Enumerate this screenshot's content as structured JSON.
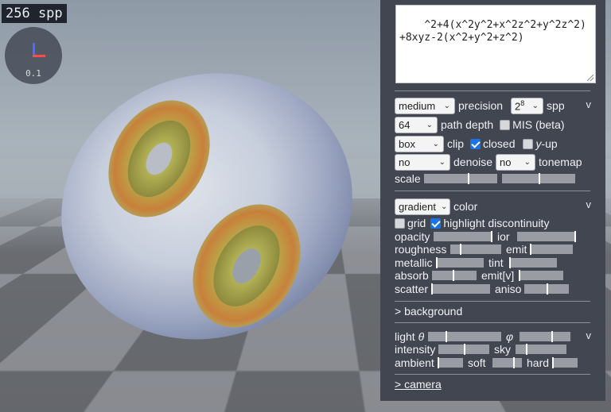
{
  "viewport": {
    "spp_label": "256 spp",
    "axes_scale": "0.1"
  },
  "panel": {
    "formula": "^2+4(x^2y^2+x^2z^2+y^2z^2)+8xyz-2(x^2+y^2+z^2)",
    "render": {
      "precision_value": "medium",
      "precision_label": "precision",
      "spp_value_base": "2",
      "spp_value_exp": "8",
      "spp_label": "spp",
      "toggle": "v",
      "path_depth_value": "64",
      "path_depth_label": "path depth",
      "mis_label": "MIS (beta)",
      "mis_checked": false,
      "clip_value": "box",
      "clip_label": "clip",
      "closed_label": "closed",
      "closed_checked": true,
      "yup_label_italic": "y",
      "yup_label_rest": "-up",
      "yup_checked": false,
      "denoise_value": "no",
      "denoise_label": "denoise",
      "tonemap_value": "no",
      "tonemap_label": "tonemap",
      "scale_label": "scale",
      "scale_value_1": 0.6,
      "scale_value_2": 0.5
    },
    "material": {
      "color_value": "gradient",
      "color_label": "color",
      "toggle": "v",
      "grid_label": "grid",
      "grid_checked": false,
      "highlight_label": "highlight discontinuity",
      "highlight_checked": true,
      "opacity_label": "opacity",
      "opacity_value": 0.99,
      "ior_label": "ior",
      "ior_value": 0.97,
      "roughness_label": "roughness",
      "roughness_value": 0.19,
      "emit_label": "emit",
      "emit_value": 0.0,
      "metallic_label": "metallic",
      "metallic_value": 0.0,
      "tint_label": "tint",
      "tint_value": 0.0,
      "absorb_label": "absorb",
      "absorb_value": 0.47,
      "emitv_label": "emit[v]",
      "emitv_value": 0.0,
      "scatter_label": "scatter",
      "scatter_value": 0.0,
      "aniso_label": "aniso",
      "aniso_value": 0.5
    },
    "background_label": "> background",
    "lighting": {
      "toggle": "v",
      "theta_label_italic": "θ",
      "theta_label_prefix": "light",
      "theta_value": 0.24,
      "phi_label": "φ",
      "phi_value": 0.63,
      "intensity_label": "intensity",
      "intensity_value": 0.5,
      "sky_label": "sky",
      "sky_value": 0.2,
      "ambient_label": "ambient",
      "ambient_value": 0.0,
      "soft_label": "soft",
      "soft_value": 0.7,
      "hard_label": "hard",
      "hard_value": 0.0
    },
    "camera_label": "> camera"
  }
}
